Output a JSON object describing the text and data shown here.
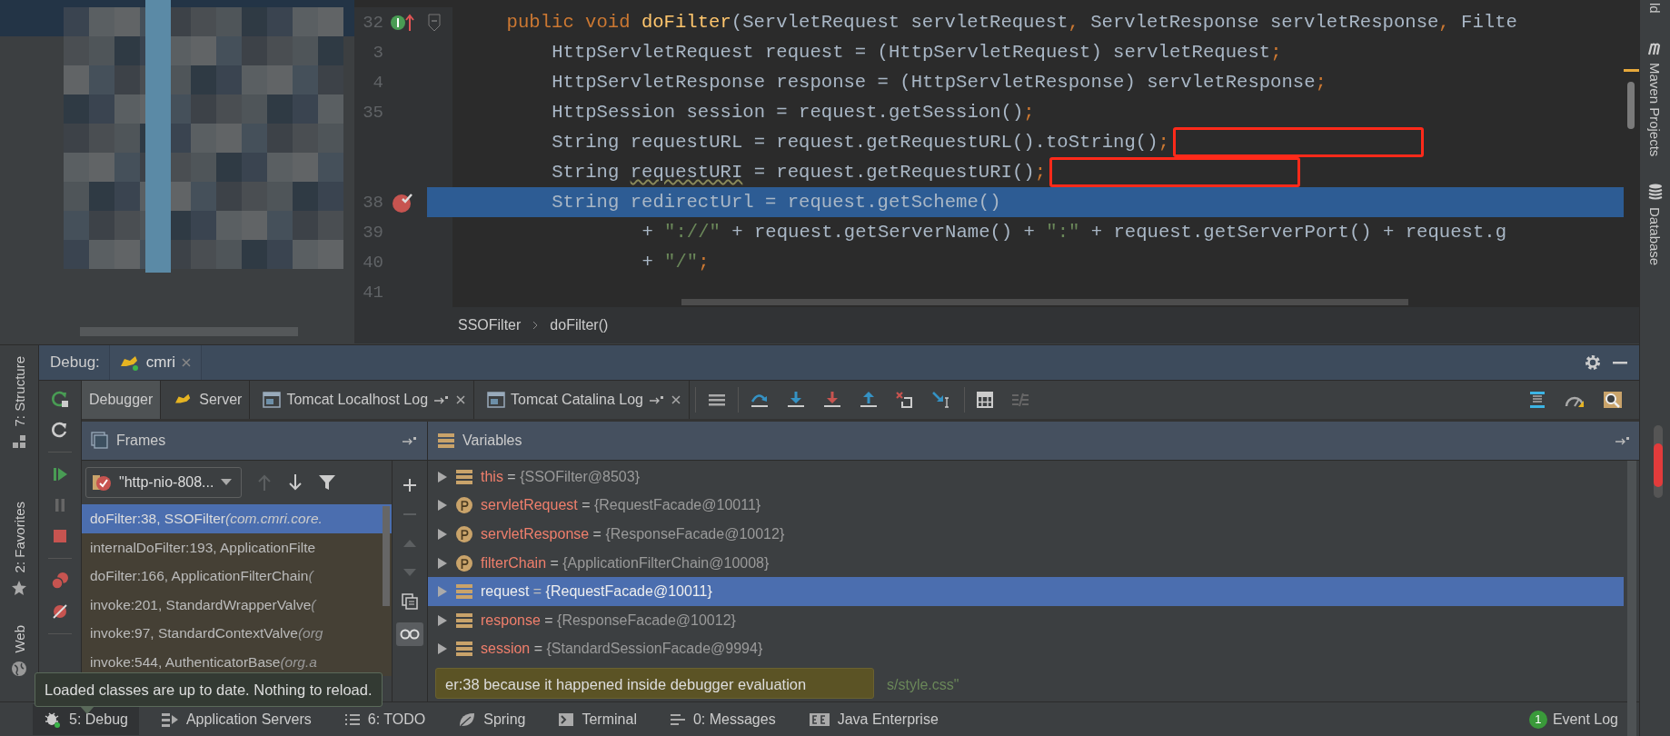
{
  "editor": {
    "lines": [
      {
        "number": "32",
        "marker": {
          "kind": "implements"
        },
        "fold": true,
        "kind": "signature",
        "current": false,
        "boxed": false,
        "segments": [
          {
            "kind": "kw",
            "text": "public void "
          },
          {
            "kind": "fn",
            "text": "doFilter"
          },
          {
            "kind": "text",
            "text": "(ServletRequest servletRequest"
          },
          {
            "kind": "kw",
            "text": ", "
          },
          {
            "kind": "text",
            "text": "ServletResponse servletResponse"
          },
          {
            "kind": "kw",
            "text": ", "
          },
          {
            "kind": "text",
            "text": "Filte"
          }
        ]
      },
      {
        "number": "3",
        "fold": false,
        "kind": "statement",
        "current": false,
        "boxed": false,
        "segments": [
          {
            "kind": "text",
            "text": "HttpServletRequest request = (HttpServletRequest) servletRequest"
          },
          {
            "kind": "kw",
            "text": ";"
          }
        ]
      },
      {
        "number": "4",
        "fold": false,
        "kind": "statement",
        "current": false,
        "boxed": false,
        "segments": [
          {
            "kind": "text",
            "text": "HttpServletResponse response = (HttpServletResponse) servletResponse"
          },
          {
            "kind": "kw",
            "text": ";"
          }
        ]
      },
      {
        "number": "35",
        "fold": false,
        "kind": "statement",
        "current": false,
        "boxed": false,
        "segments": [
          {
            "kind": "text",
            "text": "HttpSession session = request.getSession()"
          },
          {
            "kind": "kw",
            "text": ";"
          }
        ]
      },
      {
        "fold": false,
        "kind": "statement",
        "current": false,
        "boxed": true,
        "segments": [
          {
            "kind": "text",
            "text": "String requestURL = request.getRequestURL().toString()"
          },
          {
            "kind": "kw",
            "text": ";"
          }
        ]
      },
      {
        "fold": false,
        "kind": "statement",
        "current": false,
        "boxed": true,
        "segments": [
          {
            "kind": "text",
            "text": "String "
          },
          {
            "kind": "warn",
            "text": "requestURI"
          },
          {
            "kind": "text",
            "text": " = request.getRequestURI()"
          },
          {
            "kind": "kw",
            "text": ";"
          }
        ]
      },
      {
        "number": "38",
        "marker": {
          "kind": "breakpoint"
        },
        "fold": false,
        "kind": "statement",
        "current": true,
        "boxed": false,
        "segments": [
          {
            "kind": "text",
            "text": "String redirectUrl = request.getScheme()"
          }
        ]
      },
      {
        "number": "39",
        "fold": false,
        "kind": "continuation",
        "current": false,
        "boxed": false,
        "segments": [
          {
            "kind": "text",
            "text": "+ "
          },
          {
            "kind": "str",
            "text": "\"://\""
          },
          {
            "kind": "text",
            "text": " + request.getServerName() + "
          },
          {
            "kind": "str",
            "text": "\":\""
          },
          {
            "kind": "text",
            "text": " + request.getServerPort() + request.g"
          }
        ]
      },
      {
        "number": "40",
        "fold": false,
        "kind": "continuation",
        "current": false,
        "boxed": false,
        "segments": [
          {
            "kind": "text",
            "text": "+ "
          },
          {
            "kind": "str",
            "text": "\"/\""
          },
          {
            "kind": "kw",
            "text": ";"
          }
        ]
      },
      {
        "number": "41",
        "fold": false,
        "kind": "blank",
        "current": false,
        "boxed": false
      }
    ]
  },
  "breadcrumb": [
    "SSOFilter",
    "doFilter()"
  ],
  "right_stripe": [
    "ld",
    "Maven Projects",
    "Database"
  ],
  "left_stripe": [
    "7: Structure",
    "2: Favorites",
    "Web"
  ],
  "debug": {
    "title": "Debug:",
    "session": "cmri",
    "tabs": [
      {
        "label": "Debugger",
        "kind": "plain",
        "selected": true
      },
      {
        "label": "Server",
        "kind": "server",
        "selected": false
      },
      {
        "label": "Tomcat Localhost Log",
        "kind": "log",
        "selected": false
      },
      {
        "label": "Tomcat Catalina Log",
        "kind": "log",
        "selected": false
      }
    ],
    "frames_title": "Frames",
    "variables_title": "Variables",
    "thread": "\"http-nio-808...",
    "frames": [
      {
        "method": "doFilter:38, SSOFilter",
        "package": "(com.cmri.core.",
        "selected": true
      },
      {
        "method": "internalDoFilter:193, ApplicationFilte",
        "selected": false
      },
      {
        "method": "doFilter:166, ApplicationFilterChain",
        "package": "(",
        "selected": false
      },
      {
        "method": "invoke:201, StandardWrapperValve",
        "package": "(",
        "selected": false
      },
      {
        "method": "invoke:97, StandardContextValve",
        "package": "(org",
        "selected": false
      },
      {
        "method": "invoke:544, AuthenticatorBase",
        "package": "(org.a",
        "selected": false
      }
    ],
    "variables": [
      {
        "kind": "field",
        "name": "this",
        "operator": "=",
        "value": "{SSOFilter@8503}",
        "selected": false
      },
      {
        "kind": "param",
        "name": "servletRequest",
        "operator": "=",
        "value": "{RequestFacade@10011}",
        "selected": false
      },
      {
        "kind": "param",
        "name": "servletResponse",
        "operator": "=",
        "value": "{ResponseFacade@10012}",
        "selected": false
      },
      {
        "kind": "param",
        "name": "filterChain",
        "operator": "=",
        "value": "{ApplicationFilterChain@10008}",
        "selected": false
      },
      {
        "kind": "field",
        "name": "request",
        "operator": "=",
        "value": "{RequestFacade@10011}",
        "selected": true
      },
      {
        "kind": "field",
        "name": "response",
        "operator": "=",
        "value": "{ResponseFacade@10012}",
        "selected": false
      },
      {
        "kind": "field",
        "name": "session",
        "operator": "=",
        "value": "{StandardSessionFacade@9994}",
        "selected": false
      }
    ],
    "partial_value": "s/style.css\""
  },
  "notification": "er:38 because it happened inside debugger evaluation",
  "tooltip": "Loaded classes are up to date. Nothing to reload.",
  "bottom_tabs": [
    {
      "label": "5: Debug",
      "kind": "bug",
      "selected": true
    },
    {
      "label": "Application Servers",
      "kind": "servers",
      "selected": false
    },
    {
      "label": "6: TODO",
      "kind": "todo",
      "selected": false
    },
    {
      "label": "Spring",
      "kind": "spring",
      "selected": false
    },
    {
      "label": "Terminal",
      "kind": "terminal",
      "selected": false
    },
    {
      "label": "0: Messages",
      "kind": "messages",
      "selected": false
    },
    {
      "label": "Java Enterprise",
      "kind": "javaee",
      "selected": false
    }
  ],
  "event_log": {
    "count": "1",
    "label": "Event Log"
  }
}
